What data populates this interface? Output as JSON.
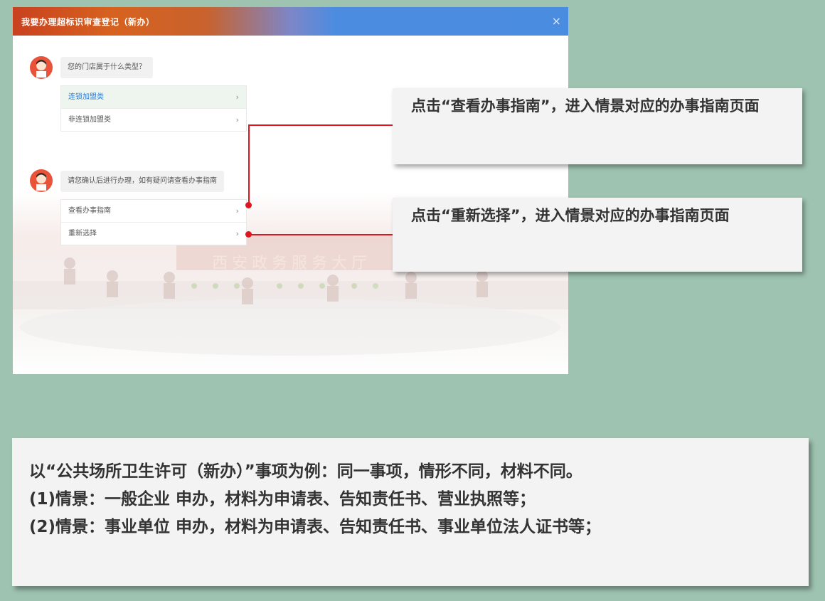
{
  "dialog": {
    "title": "我要办理超标识审查登记（新办）",
    "close_glyph": "×",
    "hall_text": "西安政务服务大厅",
    "questions": [
      {
        "text": "您的门店属于什么类型？",
        "options": [
          {
            "label": "连锁加盟类",
            "active": true
          },
          {
            "label": "非连锁加盟类",
            "active": false
          }
        ]
      },
      {
        "text": "请您确认后进行办理，如有疑问请查看办事指南",
        "options": [
          {
            "label": "查看办事指南",
            "active": false
          },
          {
            "label": "重新选择",
            "active": false
          }
        ]
      }
    ],
    "chevron": "›"
  },
  "callouts": [
    {
      "text": "点击“查看办事指南”，进入情景对应的办事指南页面"
    },
    {
      "text": "点击“重新选择”，进入情景对应的办事指南页面"
    }
  ],
  "info": {
    "lines": [
      "以“公共场所卫生许可（新办）”事项为例：同一事项，情形不同，材料不同。",
      "(1)情景：一般企业 申办，材料为申请表、告知责任书、营业执照等；",
      "(2)情景：事业单位 申办，材料为申请表、告知责任书、事业单位法人证书等；"
    ]
  },
  "colors": {
    "background": "#9ec3b0",
    "accent_red": "#e0161e",
    "header_blue": "#4a8ce0",
    "header_orange": "#c9411f"
  }
}
